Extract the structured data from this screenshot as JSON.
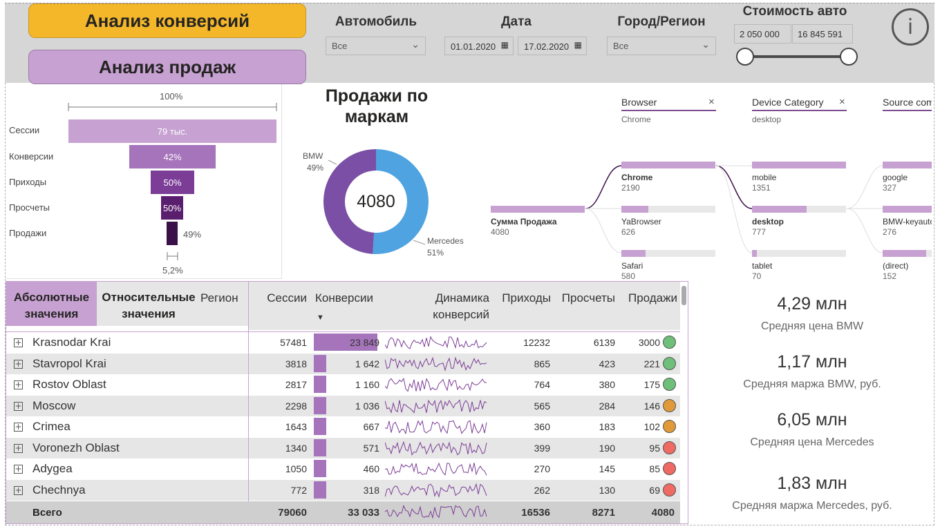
{
  "header": {
    "btn_conversions": "Анализ конверсий",
    "btn_sales": "Анализ продаж",
    "filter_car_label": "Автомобиль",
    "filter_car_value": "Все",
    "filter_date_label": "Дата",
    "date_from": "01.01.2020",
    "date_to": "17.02.2020",
    "filter_city_label": "Город/Регион",
    "filter_city_value": "Все",
    "filter_price_label": "Стоимость авто",
    "price_min": "2 050 000",
    "price_max": "16 845 591",
    "info_glyph": "i"
  },
  "funnel": {
    "top_label": "100%",
    "stages": [
      {
        "label": "Сессии",
        "value_text": "79 тыс.",
        "color": "#c6a1d1"
      },
      {
        "label": "Конверсии",
        "value_text": "42%",
        "color": "#a574ba"
      },
      {
        "label": "Приходы",
        "value_text": "50%",
        "color": "#7b3d96"
      },
      {
        "label": "Просчеты",
        "value_text": "50%",
        "color": "#5a1e6e"
      },
      {
        "label": "Продажи",
        "value_text": "49%",
        "color": "#3b0f47"
      }
    ],
    "bottom_label": "5,2%"
  },
  "donut": {
    "title": "Продажи по маркам",
    "center_value": "4080",
    "slices": [
      {
        "name": "BMW",
        "pct_text": "49%",
        "share": 0.49,
        "color": "#7a4fa5"
      },
      {
        "name": "Mercedes",
        "pct_text": "51%",
        "share": 0.51,
        "color": "#4fa3e0"
      }
    ]
  },
  "tree": {
    "headers": [
      {
        "title": "Browser",
        "sub": "Chrome"
      },
      {
        "title": "Device Category",
        "sub": "desktop"
      },
      {
        "title": "Source comp",
        "sub": ""
      }
    ],
    "root": {
      "name": "Сумма Продажа",
      "value": "4080"
    },
    "browser": [
      {
        "name": "Chrome",
        "value": "2190",
        "share": 1.0
      },
      {
        "name": "YaBrowser",
        "value": "626",
        "share": 0.29
      },
      {
        "name": "Safari",
        "value": "580",
        "share": 0.26
      }
    ],
    "device": [
      {
        "name": "mobile",
        "value": "1351",
        "share": 1.0
      },
      {
        "name": "desktop",
        "value": "777",
        "share": 0.58
      },
      {
        "name": "tablet",
        "value": "70",
        "share": 0.05
      }
    ],
    "source": [
      {
        "name": "google",
        "value": "327",
        "share": 1.0
      },
      {
        "name": "BMW-keyauto",
        "value": "276",
        "share": 0.84
      },
      {
        "name": "(direct)",
        "value": "152",
        "share": 0.46
      }
    ]
  },
  "table": {
    "tab_absolute": "Абсолютные значения",
    "tab_relative": "Относительные значения",
    "columns": {
      "region": "Регион",
      "sessions": "Сессии",
      "conversions": "Конверсии",
      "dynamics": "Динамика конверсий",
      "arrivals": "Приходы",
      "calcs": "Просчеты",
      "sales": "Продажи"
    },
    "sort_indicator": "▼",
    "rows": [
      {
        "region": "Krasnodar Krai",
        "sessions": "57481",
        "conversions": "23 849",
        "conv_num": 23849,
        "arrivals": "12232",
        "calcs": "6139",
        "sales": "3000",
        "status": "#6dbf7a"
      },
      {
        "region": "Stavropol Krai",
        "sessions": "3818",
        "conversions": "1 642",
        "conv_num": 1642,
        "arrivals": "865",
        "calcs": "423",
        "sales": "221",
        "status": "#6dbf7a"
      },
      {
        "region": "Rostov Oblast",
        "sessions": "2817",
        "conversions": "1 160",
        "conv_num": 1160,
        "arrivals": "764",
        "calcs": "380",
        "sales": "175",
        "status": "#6dbf7a"
      },
      {
        "region": "Moscow",
        "sessions": "2298",
        "conversions": "1 036",
        "conv_num": 1036,
        "arrivals": "565",
        "calcs": "284",
        "sales": "146",
        "status": "#e09a3a"
      },
      {
        "region": "Crimea",
        "sessions": "1643",
        "conversions": "667",
        "conv_num": 667,
        "arrivals": "360",
        "calcs": "183",
        "sales": "102",
        "status": "#e09a3a"
      },
      {
        "region": "Voronezh Oblast",
        "sessions": "1340",
        "conversions": "571",
        "conv_num": 571,
        "arrivals": "399",
        "calcs": "190",
        "sales": "95",
        "status": "#ee6a62"
      },
      {
        "region": "Adygea",
        "sessions": "1050",
        "conversions": "460",
        "conv_num": 460,
        "arrivals": "270",
        "calcs": "145",
        "sales": "85",
        "status": "#ee6a62"
      },
      {
        "region": "Chechnya",
        "sessions": "772",
        "conversions": "318",
        "conv_num": 318,
        "arrivals": "262",
        "calcs": "130",
        "sales": "69",
        "status": "#ee6a62"
      }
    ],
    "total": {
      "label": "Всего",
      "sessions": "79060",
      "conversions": "33 033",
      "arrivals": "16536",
      "calcs": "8271",
      "sales": "4080"
    }
  },
  "kpis": [
    {
      "value": "4,29 млн",
      "label": "Средняя цена BMW"
    },
    {
      "value": "1,17 млн",
      "label": "Средняя маржа BMW, руб."
    },
    {
      "value": "6,05 млн",
      "label": "Средняя цена Mercedes"
    },
    {
      "value": "1,83 млн",
      "label": "Средняя маржа Mercedes, руб."
    }
  ],
  "colors": {
    "accent_purple": "#c6a1d1",
    "accent_orange": "#f4b72a",
    "bar_purple": "#a574ba",
    "spark_line": "#7b3d96"
  }
}
